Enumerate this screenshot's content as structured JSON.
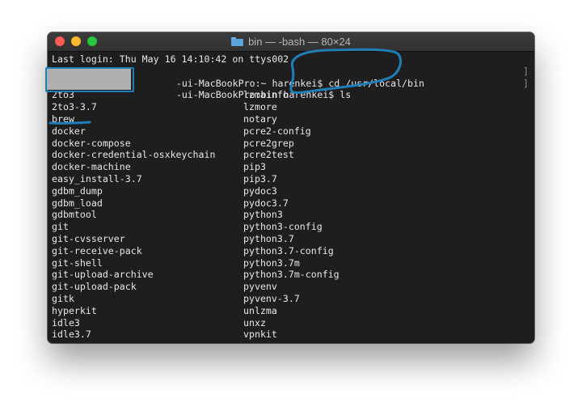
{
  "window": {
    "title": "bin — -bash — 80×24",
    "icon": "folder-icon"
  },
  "terminal": {
    "login_line": "Last login: Thu May 16 14:10:42 on ttys002",
    "prompt1_rest": "-ui-MacBookPro:~ harenkei$",
    "cmd1": "cd /usr/local/bin",
    "prompt2_rest": "-ui-MacBookPro:bin harenkei$",
    "cmd2": "ls",
    "right_bracket": "]",
    "listing_left": [
      "2to3",
      "2to3-3.7",
      "brew",
      "docker",
      "docker-compose",
      "docker-credential-osxkeychain",
      "docker-machine",
      "easy_install-3.7",
      "gdbm_dump",
      "gdbm_load",
      "gdbmtool",
      "git",
      "git-cvsserver",
      "git-receive-pack",
      "git-shell",
      "git-upload-archive",
      "git-upload-pack",
      "gitk",
      "hyperkit",
      "idle3",
      "idle3.7"
    ],
    "listing_right": [
      "lzmainfo",
      "lzmore",
      "notary",
      "pcre2-config",
      "pcre2grep",
      "pcre2test",
      "pip3",
      "pip3.7",
      "pydoc3",
      "pydoc3.7",
      "python3",
      "python3-config",
      "python3.7",
      "python3.7-config",
      "python3.7m",
      "python3.7m-config",
      "pyvenv",
      "pyvenv-3.7",
      "unlzma",
      "unxz",
      "vpnkit"
    ]
  },
  "annotations": {
    "highlight_color": "#1e7fb8",
    "redaction_color": "#b0b0b0"
  }
}
